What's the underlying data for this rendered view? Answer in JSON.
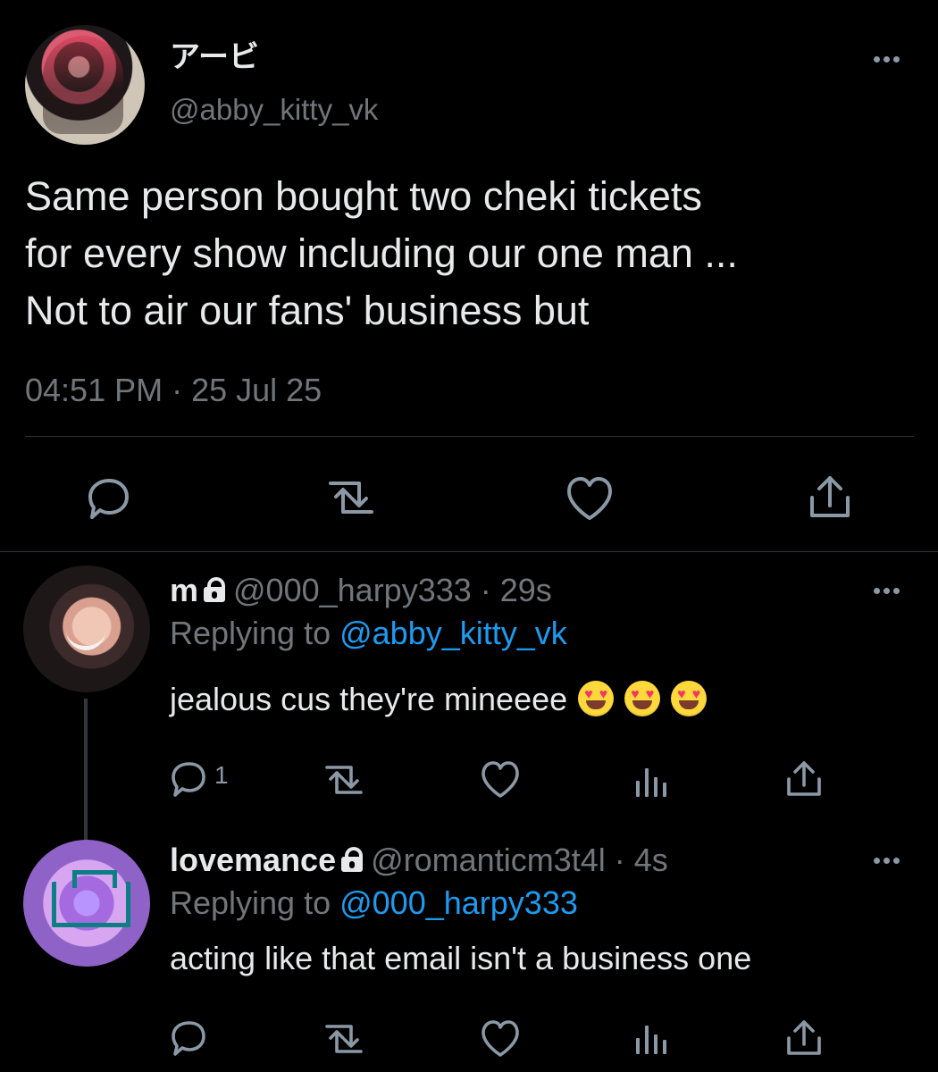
{
  "main": {
    "name": "アービ",
    "handle": "@abby_kitty_vk",
    "text": "Same person bought two cheki tickets\nfor every show including our one man ...\nNot to air our fans' business but",
    "timestamp": "04:51 PM · 25 Jul 25",
    "icons": [
      "more-icon",
      "reply-icon",
      "retweet-icon",
      "like-icon",
      "share-icon"
    ]
  },
  "replies": [
    {
      "name": "m",
      "handle": "@000_harpy333",
      "time_sep": " · ",
      "time": "29s",
      "replying_label": "Replying to ",
      "replying_to": "@abby_kitty_vk",
      "text": "jealous cus they're mineeee",
      "emoji_count": 3,
      "reply_count": "1",
      "icons": [
        "more-icon",
        "lock-icon",
        "reply-icon",
        "retweet-icon",
        "like-icon",
        "analytics-icon",
        "share-icon"
      ]
    },
    {
      "name": "lovemance",
      "handle": "@romanticm3t4l",
      "time_sep": " · ",
      "time": "4s",
      "replying_label": "Replying to ",
      "replying_to": "@000_harpy333",
      "text": "acting like that email isn't a business one",
      "icons": [
        "more-icon",
        "lock-icon",
        "reply-icon",
        "retweet-icon",
        "like-icon",
        "analytics-icon",
        "share-icon"
      ]
    }
  ],
  "colors": {
    "background": "#000000",
    "primary_text": "#e7e9ea",
    "secondary_text": "#71767b",
    "link": "#1d9bf0",
    "divider": "#2f3336",
    "icon": "#8b98a5"
  }
}
